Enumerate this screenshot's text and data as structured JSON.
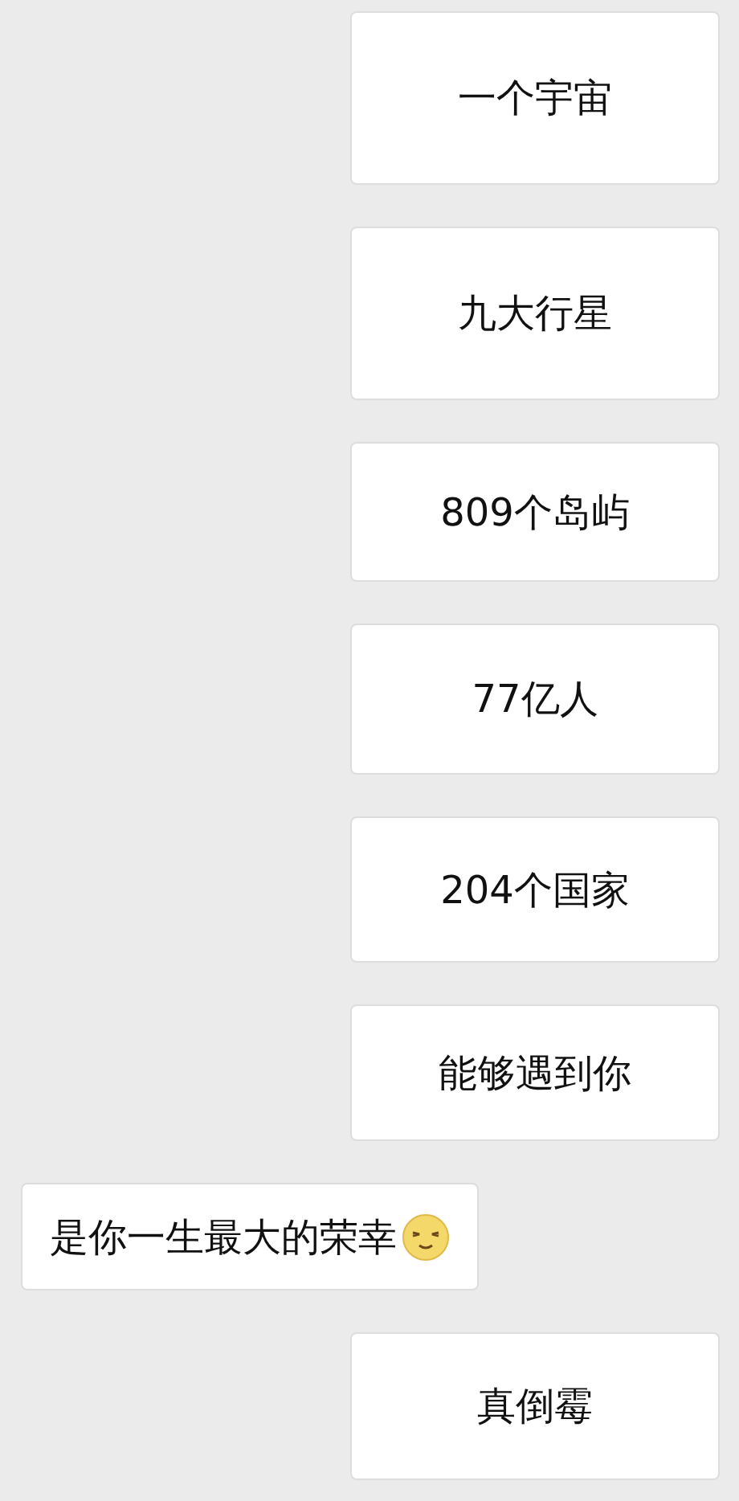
{
  "messages": [
    {
      "kind": "outgoing",
      "text": "一个宇宙"
    },
    {
      "kind": "outgoing",
      "text": "九大行星"
    },
    {
      "kind": "outgoing",
      "text": "809个岛屿"
    },
    {
      "kind": "outgoing",
      "text": "77亿人"
    },
    {
      "kind": "outgoing",
      "text": "204个国家"
    },
    {
      "kind": "outgoing",
      "text": "能够遇到你"
    },
    {
      "kind": "incoming",
      "text": "是你一生最大的荣幸",
      "emoji": true
    },
    {
      "kind": "outgoing",
      "text": "真倒霉"
    }
  ]
}
